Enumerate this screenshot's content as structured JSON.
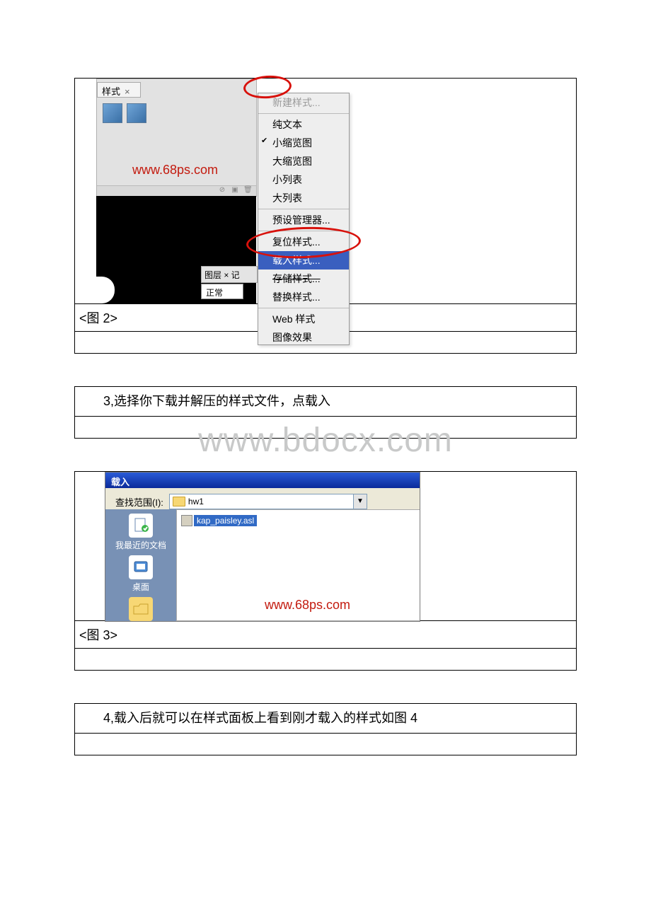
{
  "fig2": {
    "tab_label": "样式",
    "thumb_count": 2,
    "url": "www.68ps.com",
    "panel_icons": [
      "⊘",
      "▣",
      "🗑"
    ],
    "layer_tab": "图层 × 记",
    "mode": "正常",
    "menu": {
      "new_style": "新建样式...",
      "view_group": [
        "纯文本",
        "小缩览图",
        "大缩览图",
        "小列表",
        "大列表"
      ],
      "checked": "小缩览图",
      "preset_manager": "预设管理器...",
      "ops": [
        "复位样式...",
        "载入样式...",
        "存储样式...",
        "替换样式..."
      ],
      "highlighted": "载入样式...",
      "web": "Web 样式",
      "last": "图像效果"
    },
    "caption": "<图 2>"
  },
  "step3": "3,选择你下载并解压的样式文件，点载入",
  "fig3": {
    "title": "载入",
    "lookin_label": "查找范围(I):",
    "lookin_value": "hw1",
    "file": "kap_paisley.asl",
    "sidebar": {
      "recent": "我最近的文档",
      "desktop": "桌面"
    },
    "url": "www.68ps.com",
    "caption": "<图 3>"
  },
  "step4": "4,载入后就可以在样式面板上看到刚才载入的样式如图 4",
  "watermark": "www.bdocx.com"
}
